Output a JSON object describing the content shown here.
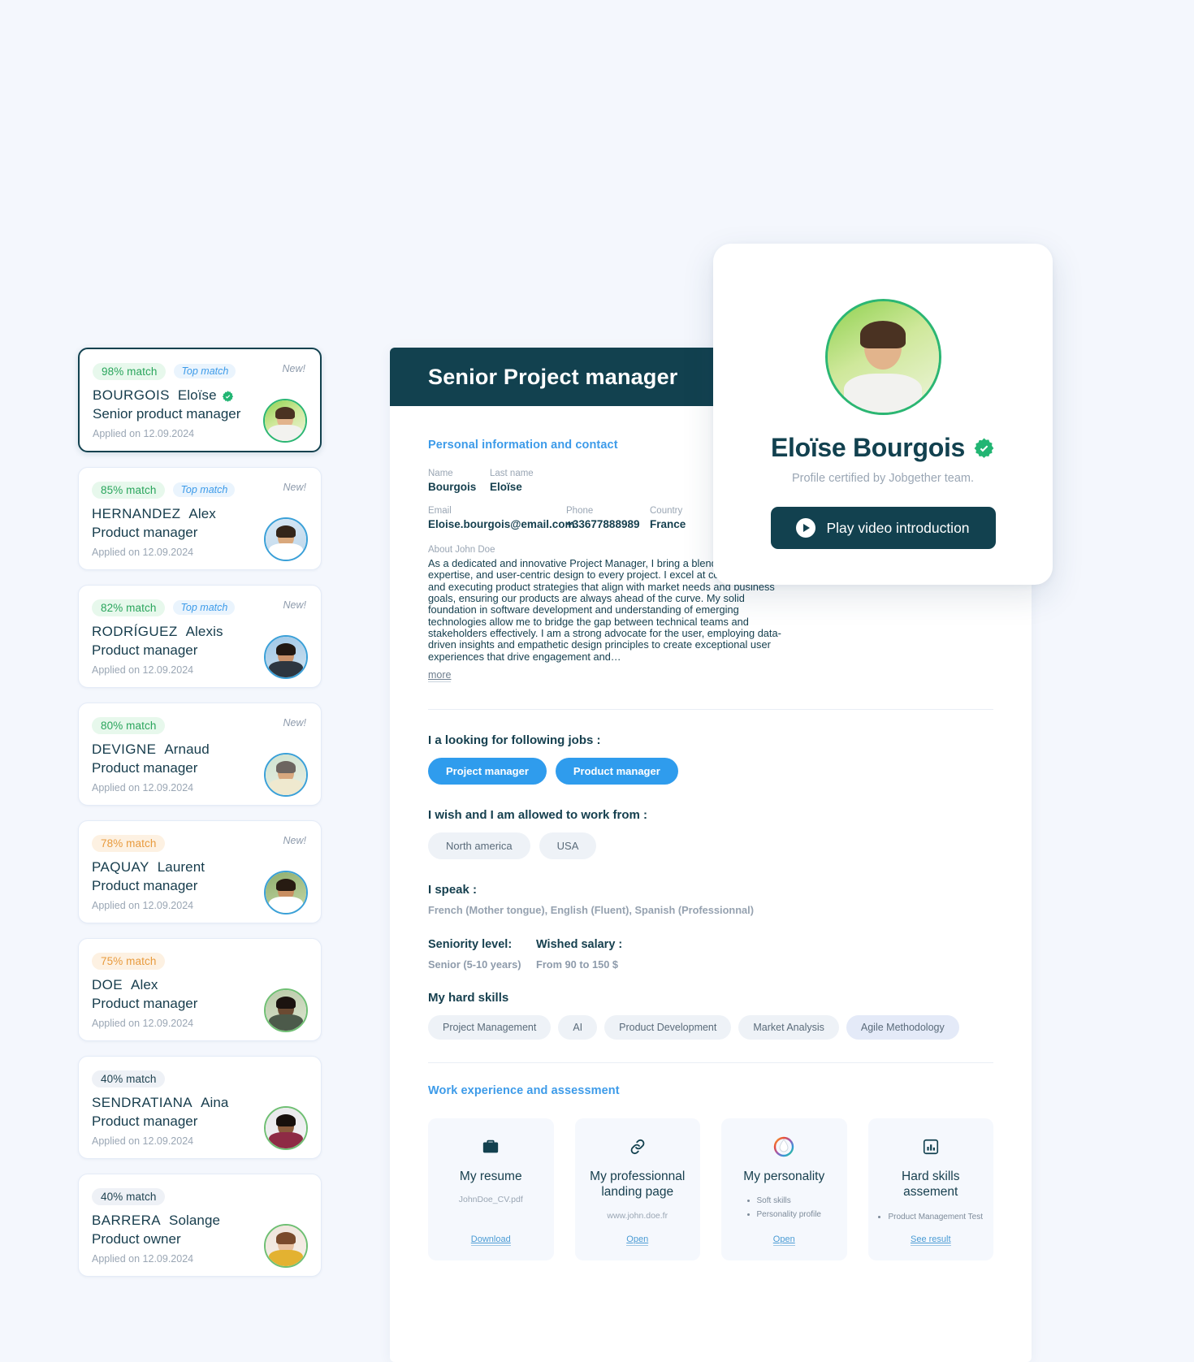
{
  "candidates": [
    {
      "match": "98% match",
      "match_tone": "green",
      "top": "Top match",
      "new": "New!",
      "surname": "BOURGOIS",
      "given": "Eloïse",
      "role": "Senior product manager",
      "applied": "Applied on 12.09.2024",
      "verified": true,
      "selected": true,
      "avatar": {
        "bg": "linear-gradient(150deg,#8fd14f 0%,#cfe89b 45%,#eef5dc 100%)",
        "skin": "#e2b48c",
        "hair": "#4a3222",
        "cloth": "#f2f2ef",
        "ring": "#2bb673"
      }
    },
    {
      "match": "85% match",
      "match_tone": "green",
      "top": "Top match",
      "new": "New!",
      "surname": "HERNANDEZ",
      "given": "Alex",
      "role": "Product manager",
      "applied": "Applied on 12.09.2024",
      "verified": false,
      "selected": false,
      "avatar": {
        "bg": "linear-gradient(160deg,#d8e8f5 0%,#bdd6ea 100%)",
        "skin": "#d9a87c",
        "hair": "#33251a",
        "cloth": "#ffffff",
        "ring": "#3aa0d8"
      }
    },
    {
      "match": "82% match",
      "match_tone": "green",
      "top": "Top match",
      "new": "New!",
      "surname": "RODRÍGUEZ",
      "given": "Alexis",
      "role": "Product manager",
      "applied": "Applied on 12.09.2024",
      "verified": false,
      "selected": false,
      "avatar": {
        "bg": "linear-gradient(160deg,#9fc7e6 0%,#cfe2f0 100%)",
        "skin": "#c9926a",
        "hair": "#211812",
        "cloth": "#2d3640",
        "ring": "#3aa0d8"
      }
    },
    {
      "match": "80% match",
      "match_tone": "green",
      "top": "",
      "new": "New!",
      "surname": "DEVIGNE",
      "given": "Arnaud",
      "role": "Product manager",
      "applied": "Applied on 12.09.2024",
      "verified": false,
      "selected": false,
      "avatar": {
        "bg": "linear-gradient(160deg,#cfe2cf 0%,#eaf0e4 100%)",
        "skin": "#d8a87e",
        "hair": "#6d6560",
        "cloth": "#efe9cf",
        "ring": "#3aa0d8"
      }
    },
    {
      "match": "78% match",
      "match_tone": "orange",
      "top": "",
      "new": "New!",
      "surname": "PAQUAY",
      "given": "Laurent",
      "role": "Product manager",
      "applied": "Applied on 12.09.2024",
      "verified": false,
      "selected": false,
      "avatar": {
        "bg": "linear-gradient(160deg,#8fae6e 0%,#c6d9a8 100%)",
        "skin": "#c98f62",
        "hair": "#271b12",
        "cloth": "#ffffff",
        "ring": "#3aa0d8"
      }
    },
    {
      "match": "75% match",
      "match_tone": "orange",
      "top": "",
      "new": "",
      "surname": "DOE",
      "given": "Alex",
      "role": "Product manager",
      "applied": "Applied on 12.09.2024",
      "verified": false,
      "selected": false,
      "avatar": {
        "bg": "linear-gradient(160deg,#b9c9a8 0%,#dde6d0 100%)",
        "skin": "#6b4a32",
        "hair": "#1b1310",
        "cloth": "#4c5a4a",
        "ring": "#6fbf73"
      }
    },
    {
      "match": "40% match",
      "match_tone": "grey",
      "top": "",
      "new": "",
      "surname": "SENDRATIANA",
      "given": "Aina",
      "role": "Product manager",
      "applied": "Applied on 12.09.2024",
      "verified": false,
      "selected": false,
      "avatar": {
        "bg": "linear-gradient(160deg,#e8e8ea 0%,#f3f3f5 100%)",
        "skin": "#8a5c3c",
        "hair": "#17100c",
        "cloth": "#8e2b45",
        "ring": "#6fbf73"
      }
    },
    {
      "match": "40% match",
      "match_tone": "grey",
      "top": "",
      "new": "",
      "surname": "BARRERA",
      "given": "Solange",
      "role": "Product owner",
      "applied": "Applied on 12.09.2024",
      "verified": false,
      "selected": false,
      "avatar": {
        "bg": "linear-gradient(160deg,#efe4dc 0%,#f7efe8 100%)",
        "skin": "#e8c0a0",
        "hair": "#7a4a2c",
        "cloth": "#e3b231",
        "ring": "#6fbf73"
      }
    }
  ],
  "main": {
    "title": "Senior Project manager",
    "personal_section": "Personal information and contact",
    "fields": {
      "name_label": "Name",
      "name_value": "Bourgois",
      "lastname_label": "Last name",
      "lastname_value": "Eloïse",
      "email_label": "Email",
      "email_value": "Eloise.bourgois@email.com",
      "phone_label": "Phone",
      "phone_value": "+33677888989",
      "country_label": "Country",
      "country_value": "France"
    },
    "about_label": "About John Doe",
    "about_text": "As a dedicated and innovative Project  Manager, I bring a blend of st. technical expertise, and user-centric design to every project. I excel at conceptualizing and executing product strategies that align with market needs and business goals, ensuring our products are always ahead of the curve. My solid foundation in software development and understanding of emerging technologies allow me to bridge the gap between technical teams and stakeholders effectively. I am a strong advocate for the user, employing data-driven insights and empathetic design principles to create exceptional user experiences that drive engagement and…",
    "more_label": "more",
    "jobs_label": "I a looking for following jobs :",
    "jobs": [
      "Project manager",
      "Product manager"
    ],
    "locations_label": "I wish and I am allowed to work from :",
    "locations": [
      "North america",
      "USA"
    ],
    "speak_label": "I speak :",
    "speak_value": "French (Mother tongue), English (Fluent), Spanish (Professionnal)",
    "seniority_label": "Seniority level:",
    "seniority_value": "Senior (5-10 years)",
    "salary_label": "Wished salary :",
    "salary_value": "From 90 to 150 $",
    "skills_label": "My hard skills",
    "skills": [
      "Project Management",
      "AI",
      "Product Development",
      "Market Analysis",
      "Agile Methodology"
    ],
    "work_section": "Work experience and assessment",
    "feature_cards": [
      {
        "icon": "briefcase-icon",
        "title": "My resume",
        "sub": "JohnDoe_CV.pdf",
        "bullets": [],
        "link": "Download"
      },
      {
        "icon": "link-icon",
        "title": "My professionnal landing page",
        "sub": "www.john.doe.fr",
        "bullets": [],
        "link": "Open"
      },
      {
        "icon": "palette-icon",
        "title": "My personality",
        "sub": "",
        "bullets": [
          "Soft skills",
          "Personality profile"
        ],
        "link": "Open"
      },
      {
        "icon": "chart-icon",
        "title": "Hard skills assement",
        "sub": "",
        "bullets": [
          "Product Management Test"
        ],
        "link": "See result"
      }
    ]
  },
  "profile_card": {
    "name": "Eloïse Bourgois",
    "certified": "Profile certified by Jobgether team.",
    "play_label": "Play video introduction"
  },
  "colors": {
    "dark_teal": "#12414f",
    "accent_blue": "#3d9be9",
    "pill_blue": "#2f9ced",
    "green": "#2aa55c",
    "orange": "#e89b3e",
    "page_bg": "#f4f7fd"
  }
}
